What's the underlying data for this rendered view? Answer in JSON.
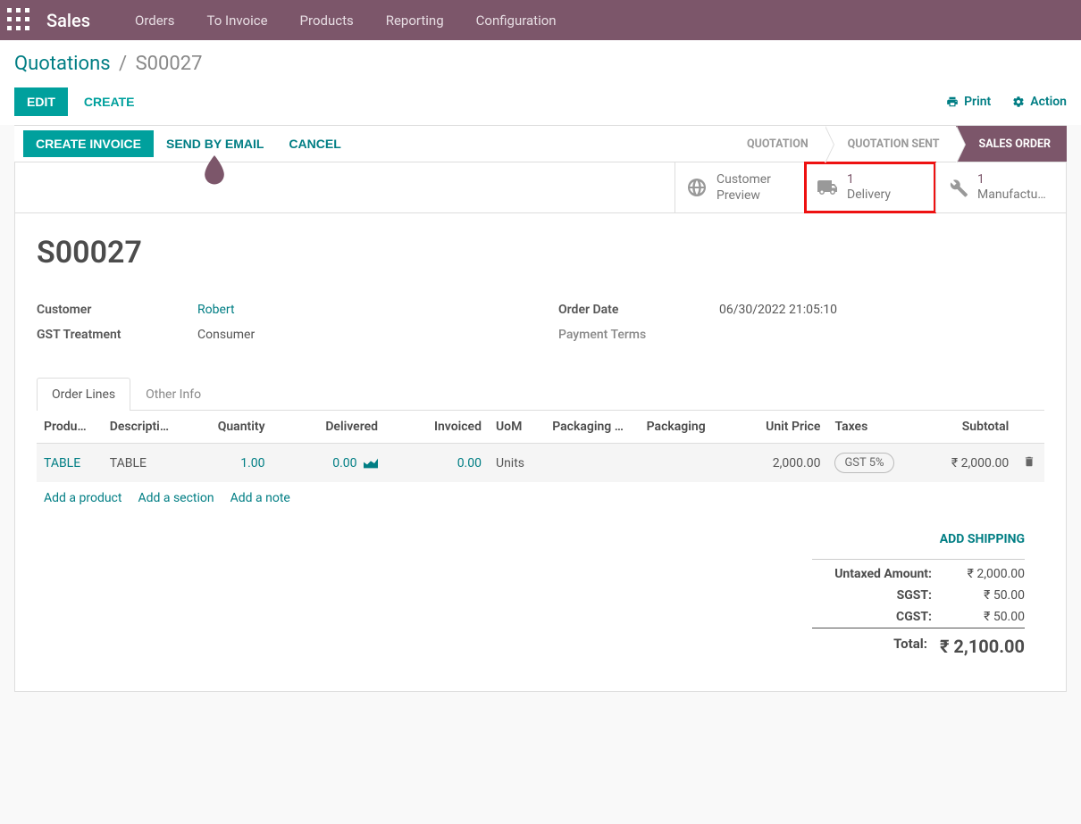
{
  "nav": {
    "app": "Sales",
    "menu": [
      "Orders",
      "To Invoice",
      "Products",
      "Reporting",
      "Configuration"
    ]
  },
  "breadcrumb": {
    "root": "Quotations",
    "leaf": "S00027"
  },
  "buttons": {
    "edit": "EDIT",
    "create": "CREATE",
    "print": "Print",
    "action": "Action",
    "create_invoice": "CREATE INVOICE",
    "send_email": "SEND BY EMAIL",
    "cancel": "CANCEL"
  },
  "status_flow": [
    "QUOTATION",
    "QUOTATION SENT",
    "SALES ORDER"
  ],
  "stat_boxes": {
    "preview": {
      "line1": "Customer",
      "line2": "Preview"
    },
    "delivery": {
      "count": "1",
      "label": "Delivery"
    },
    "manufacturing": {
      "count": "1",
      "label": "Manufactu…"
    }
  },
  "order": {
    "number": "S00027",
    "customer_label": "Customer",
    "customer": "Robert",
    "gst_label": "GST Treatment",
    "gst": "Consumer",
    "order_date_label": "Order Date",
    "order_date": "06/30/2022 21:05:10",
    "payment_terms_label": "Payment Terms",
    "payment_terms": ""
  },
  "tabs": [
    "Order Lines",
    "Other Info"
  ],
  "columns": {
    "product": "Produ…",
    "description": "Descripti…",
    "quantity": "Quantity",
    "delivered": "Delivered",
    "invoiced": "Invoiced",
    "uom": "UoM",
    "packaging_q": "Packaging …",
    "packaging": "Packaging",
    "unit_price": "Unit Price",
    "taxes": "Taxes",
    "subtotal": "Subtotal"
  },
  "lines": [
    {
      "product": "TABLE",
      "description": "TABLE",
      "quantity": "1.00",
      "delivered": "0.00",
      "invoiced": "0.00",
      "uom": "Units",
      "packaging_q": "",
      "packaging": "",
      "unit_price": "2,000.00",
      "taxes": "GST 5%",
      "subtotal": "₹ 2,000.00"
    }
  ],
  "add_links": {
    "product": "Add a product",
    "section": "Add a section",
    "note": "Add a note"
  },
  "summary": {
    "add_shipping": "ADD SHIPPING",
    "untaxed_label": "Untaxed Amount:",
    "untaxed": "₹ 2,000.00",
    "sgst_label": "SGST:",
    "sgst": "₹ 50.00",
    "cgst_label": "CGST:",
    "cgst": "₹ 50.00",
    "total_label": "Total:",
    "total": "₹ 2,100.00"
  }
}
